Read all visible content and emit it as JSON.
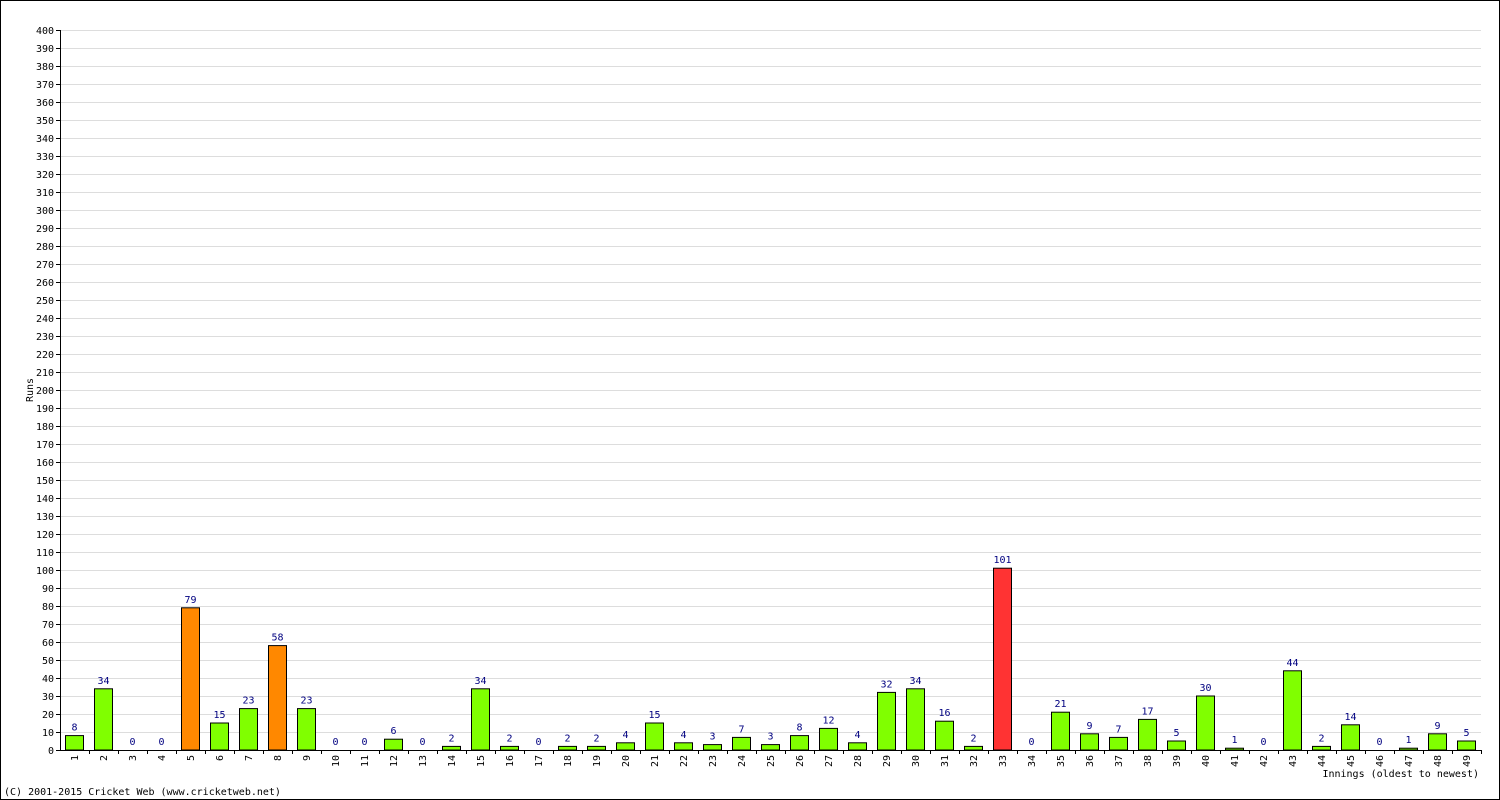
{
  "chart_data": {
    "type": "bar",
    "title": "",
    "xlabel": "Innings (oldest to newest)",
    "ylabel": "Runs",
    "ylim": [
      0,
      400
    ],
    "ytick_step": 10,
    "grid": true,
    "categories": [
      "1",
      "2",
      "3",
      "4",
      "5",
      "6",
      "7",
      "8",
      "9",
      "10",
      "11",
      "12",
      "13",
      "14",
      "15",
      "16",
      "17",
      "18",
      "19",
      "20",
      "21",
      "22",
      "23",
      "24",
      "25",
      "26",
      "27",
      "28",
      "29",
      "30",
      "31",
      "32",
      "33",
      "34",
      "35",
      "36",
      "37",
      "38",
      "39",
      "40",
      "41",
      "42",
      "43",
      "44",
      "45",
      "46",
      "47",
      "48",
      "49"
    ],
    "values": [
      8,
      34,
      0,
      0,
      79,
      15,
      23,
      58,
      23,
      0,
      0,
      6,
      0,
      2,
      34,
      2,
      0,
      2,
      2,
      4,
      15,
      4,
      3,
      7,
      3,
      8,
      12,
      4,
      32,
      34,
      16,
      2,
      101,
      0,
      21,
      9,
      7,
      17,
      5,
      30,
      1,
      0,
      44,
      2,
      14,
      0,
      1,
      9,
      5
    ],
    "colors": {
      "normal": "#80ff00",
      "fifty": "#ff8800",
      "hundred": "#ff3333",
      "value_label": "#000080",
      "grid": "#dddddd"
    }
  },
  "footer": {
    "copyright": "(C) 2001-2015 Cricket Web (www.cricketweb.net)"
  }
}
